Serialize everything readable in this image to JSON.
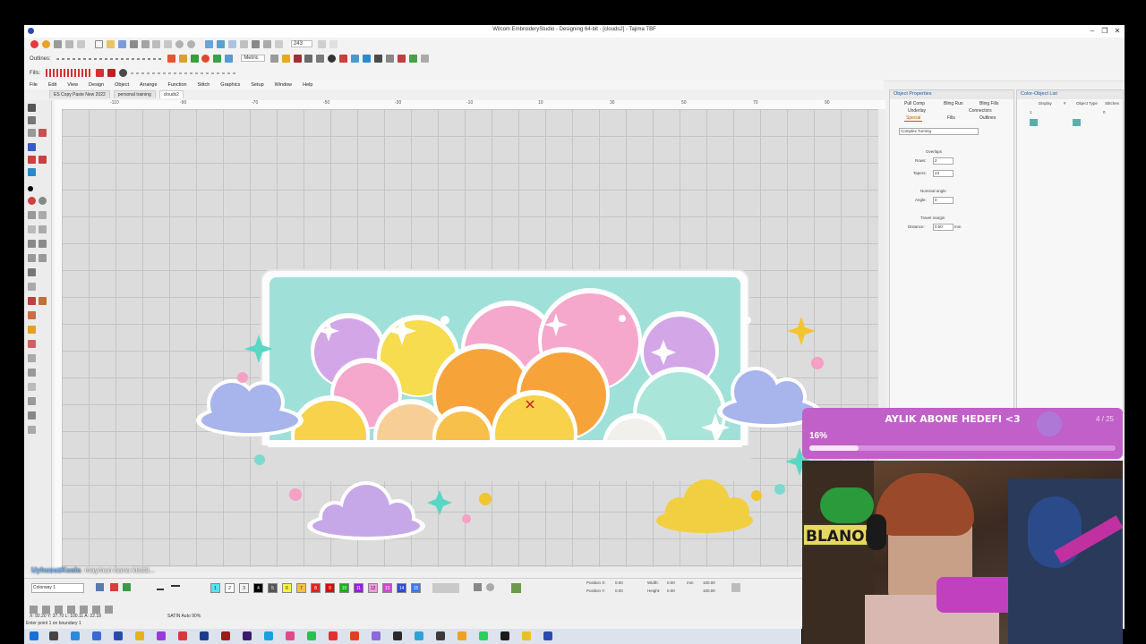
{
  "window": {
    "title": "Wilcom EmbroideryStudio - Designing 64-bit - [clouds2] - Tajima TBF",
    "min": "–",
    "max": "❐",
    "close": "✕"
  },
  "toolbar1": {
    "font_value": "243",
    "metric_label": "Metric"
  },
  "toolbar2": {
    "outlines_label": "Outlines:"
  },
  "toolbar3": {
    "fills_label": "Fills:"
  },
  "menu": [
    "File",
    "Edit",
    "View",
    "Design",
    "Object",
    "Arrange",
    "Function",
    "Stitch",
    "Graphics",
    "Setup",
    "Window",
    "Help"
  ],
  "doc_tabs": [
    "ES Copy Paste New 2022",
    "personal training",
    "clouds2"
  ],
  "ruler_numbers": [
    "-110",
    "-90",
    "-70",
    "-50",
    "-30",
    "-10",
    "10",
    "30",
    "50",
    "70",
    "90",
    "110"
  ],
  "object_properties": {
    "title": "Object Properties",
    "tabs": [
      "Pull Comp",
      "Bling Run",
      "Bling Fills",
      "Underlay",
      "Connectors",
      "Special",
      "Fills",
      "Outlines"
    ],
    "stitch_type": "Complex Turning",
    "overlaps_label": "Overlaps",
    "rows_label": "Rows:",
    "rows_value": "2",
    "tapers_label": "Tapers:",
    "tapers_value": "23",
    "nominal_angle_label": "Nominal angle",
    "angle_label": "Angle:",
    "angle_value": "0",
    "travel_margin_label": "Travel margin",
    "distance_label": "Distance:",
    "distance_value": "0.50",
    "distance_unit": "mm"
  },
  "color_object_list": {
    "title": "Color-Object List",
    "columns": [
      "Display",
      "#",
      "Object Type",
      "Stitches"
    ],
    "row": {
      "index": "1",
      "stitches": "0"
    }
  },
  "colorway": {
    "name": "Colorway 1"
  },
  "palette": [
    {
      "n": "1",
      "color": "#56e3f2"
    },
    {
      "n": "2",
      "color": "#ffffff"
    },
    {
      "n": "3",
      "color": "#f2f2f2"
    },
    {
      "n": "4",
      "color": "#000000"
    },
    {
      "n": "5",
      "color": "#555555"
    },
    {
      "n": "6",
      "color": "#f4f244"
    },
    {
      "n": "7",
      "color": "#f4c242"
    },
    {
      "n": "8",
      "color": "#e02424"
    },
    {
      "n": "9",
      "color": "#d01010"
    },
    {
      "n": "10",
      "color": "#18b018"
    },
    {
      "n": "11",
      "color": "#9a1ae0"
    },
    {
      "n": "12",
      "color": "#f09ae0"
    },
    {
      "n": "13",
      "color": "#d04ad0"
    },
    {
      "n": "14",
      "color": "#2e4ad8"
    },
    {
      "n": "15",
      "color": "#3e7ae8"
    }
  ],
  "position_panel": {
    "position_x_label": "Position X:",
    "position_x": "0.00",
    "position_y_label": "Position Y:",
    "position_y": "0.00",
    "width_label": "Width:",
    "width": "0.00",
    "height_label": "Height:",
    "height": "0.00",
    "scale_x": "100.00",
    "scale_y": "100.00",
    "unit": "mm"
  },
  "status": {
    "coords": "X: 92.20 Y: 37.70 L: 100.11 A: 22.18",
    "mode": "SATIN Auto 90%",
    "prompt": "Enter point 1 on boundary 1"
  },
  "chat": {
    "user": "UyhusuzKuala",
    "message": ": maymun bana küstü..."
  },
  "sub_goal": {
    "title": "AYLIK ABONE HEDEFI <3",
    "count": "4 / 25",
    "percent_label": "16%",
    "progress": 0.16
  },
  "webcam": {
    "sign_text": "BLANORA"
  }
}
